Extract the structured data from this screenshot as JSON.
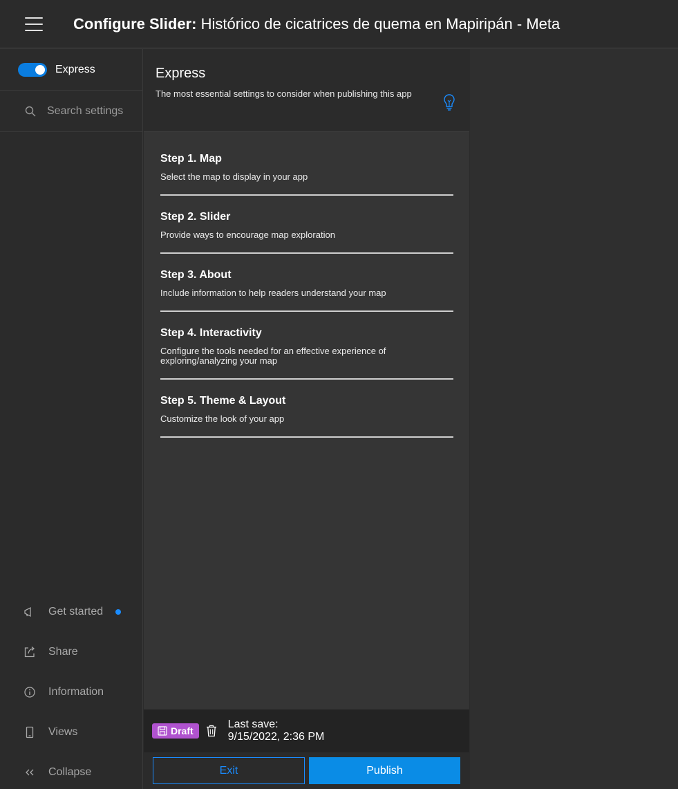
{
  "header": {
    "title_prefix": "Configure Slider:",
    "title_rest": " Histórico de cicatrices de quema en Mapiripán - Meta"
  },
  "leftnav": {
    "express_label": "Express",
    "search_placeholder": "Search settings",
    "items": [
      {
        "label": "Get started",
        "icon": "megaphone-icon",
        "has_dot": true
      },
      {
        "label": "Share",
        "icon": "share-icon"
      },
      {
        "label": "Information",
        "icon": "info-icon"
      },
      {
        "label": "Views",
        "icon": "mobile-icon"
      },
      {
        "label": "Collapse",
        "icon": "chevrons-left-icon"
      }
    ]
  },
  "panel": {
    "title": "Express",
    "description": "The most essential settings to consider when publishing this app",
    "steps": [
      {
        "title": "Step 1. Map",
        "desc": "Select the map to display in your app"
      },
      {
        "title": "Step 2. Slider",
        "desc": "Provide ways to encourage map exploration"
      },
      {
        "title": "Step 3. About",
        "desc": "Include information to help readers understand your map"
      },
      {
        "title": "Step 4. Interactivity",
        "desc": "Configure the tools needed for an effective experience of exploring/analyzing your map"
      },
      {
        "title": "Step 5. Theme & Layout",
        "desc": "Customize the look of your app"
      }
    ]
  },
  "savebar": {
    "draft_label": "Draft",
    "last_save_label": "Last save:",
    "last_save_value": "9/15/2022, 2:36 PM"
  },
  "buttons": {
    "exit_label": "Exit",
    "publish_label": "Publish"
  },
  "colors": {
    "accent": "#1a8cff",
    "draft": "#b052cf",
    "panel": "#353535",
    "background": "#2b2b2b"
  }
}
